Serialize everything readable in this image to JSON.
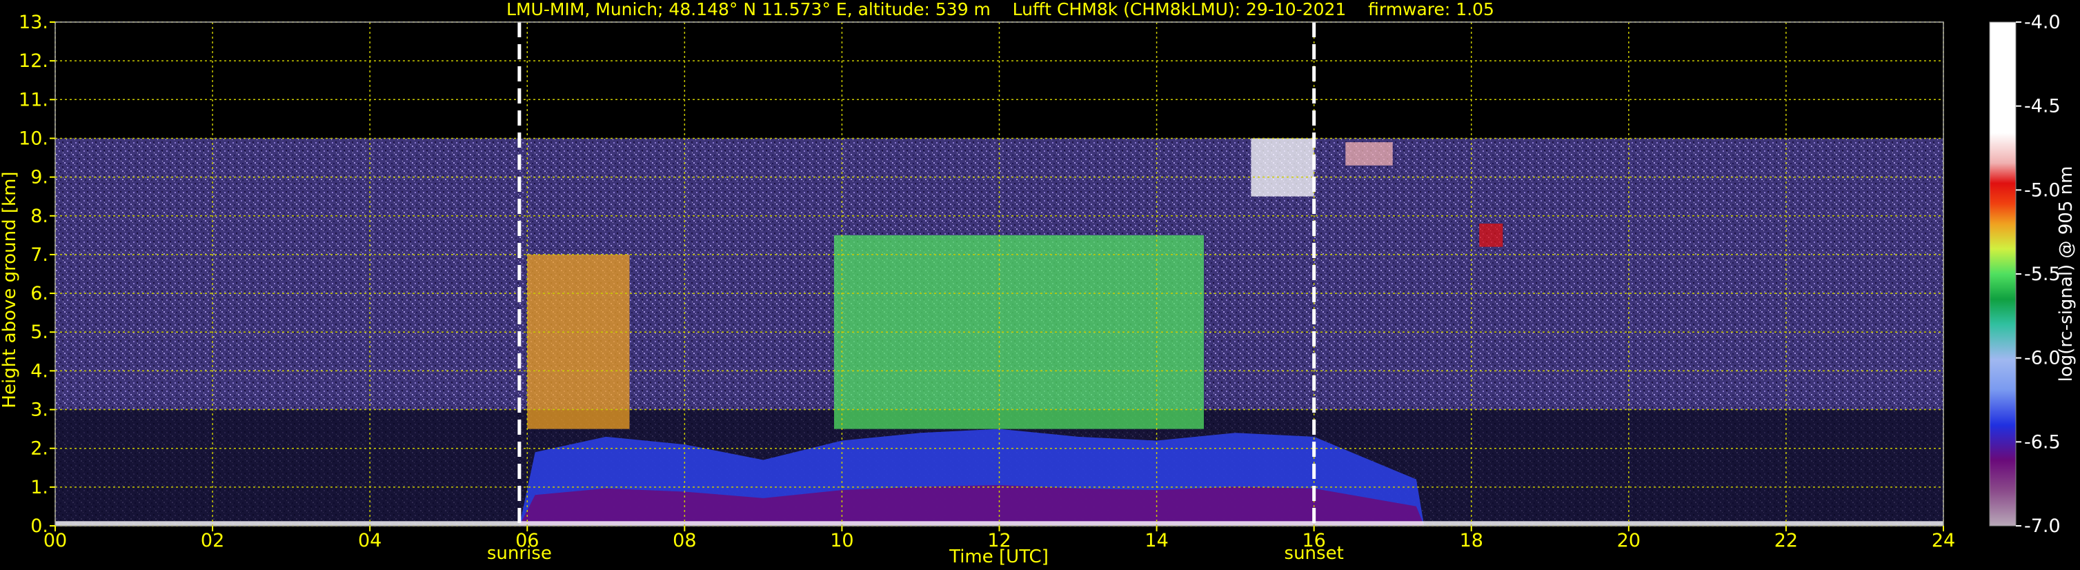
{
  "chart_data": {
    "type": "heatmap",
    "title": "LMU-MIM, Munich; 48.148° N 11.573° E, altitude: 539 m    Lufft CHM8k (CHM8kLMU): 29-10-2021    firmware: 1.05",
    "xlabel": "Time [UTC]",
    "ylabel": "Height above ground [km]",
    "xlim": [
      0,
      24
    ],
    "ylim": [
      0,
      13
    ],
    "x_ticks": [
      "00",
      "02",
      "04",
      "06",
      "08",
      "10",
      "12",
      "14",
      "16",
      "18",
      "20",
      "22",
      "24"
    ],
    "y_ticks": [
      "0.",
      "1.",
      "2.",
      "3.",
      "4.",
      "5.",
      "6.",
      "7.",
      "8.",
      "9.",
      "10.",
      "11.",
      "12.",
      "13."
    ],
    "grid": true,
    "data_top_km": 10,
    "annotations": [
      {
        "label": "sunrise",
        "x": 5.9
      },
      {
        "label": "sunset",
        "x": 16.0
      }
    ],
    "colorbar": {
      "label": "log(rc-signal) @ 905 nm",
      "range": [
        -7.0,
        -4.0
      ],
      "ticks": [
        "-4.0",
        "-4.5",
        "-5.0",
        "-5.5",
        "-6.0",
        "-6.5",
        "-7.0"
      ]
    },
    "aerosol_layer_top_km": [
      [
        0,
        0
      ],
      [
        5.9,
        0
      ],
      [
        6.1,
        1.9
      ],
      [
        7,
        2.3
      ],
      [
        8,
        2.1
      ],
      [
        9,
        1.7
      ],
      [
        10,
        2.2
      ],
      [
        11,
        2.4
      ],
      [
        12,
        2.5
      ],
      [
        13,
        2.3
      ],
      [
        14,
        2.2
      ],
      [
        15,
        2.4
      ],
      [
        16,
        2.3
      ],
      [
        17.3,
        1.2
      ],
      [
        17.4,
        0
      ],
      [
        24,
        0
      ]
    ],
    "high_signal_regions": [
      {
        "x0": 6.0,
        "x1": 7.3,
        "y0": 2.5,
        "y1": 7.0,
        "level": -5.2
      },
      {
        "x0": 9.9,
        "x1": 14.6,
        "y0": 2.5,
        "y1": 7.5,
        "level": -5.5
      },
      {
        "x0": 15.2,
        "x1": 16.0,
        "y0": 8.5,
        "y1": 10.0,
        "level": -4.3
      },
      {
        "x0": 16.4,
        "x1": 17.0,
        "y0": 9.3,
        "y1": 9.9,
        "level": -4.6
      },
      {
        "x0": 18.1,
        "x1": 18.4,
        "y0": 7.2,
        "y1": 7.8,
        "level": -5.0
      }
    ]
  },
  "colors": {
    "text": "#ffff00",
    "grid": "#cccc00",
    "background_signal": "#4a3e8c",
    "colorbar_label": "#ffffff"
  }
}
